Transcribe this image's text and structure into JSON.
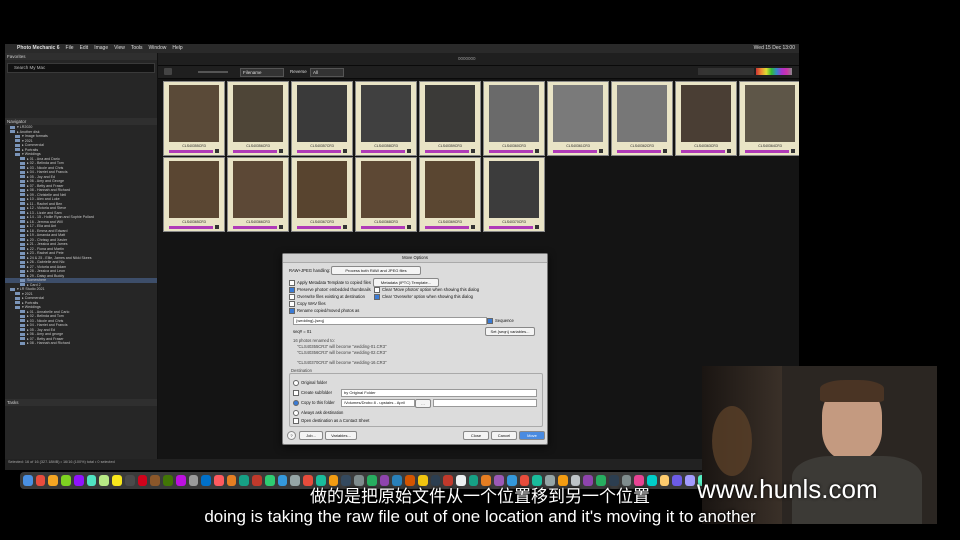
{
  "app": {
    "title": "Photo Mechanic 6"
  },
  "menubar": {
    "items": [
      "Photo Mechanic 6",
      "File",
      "Edit",
      "Image",
      "View",
      "Tools",
      "Window",
      "Help"
    ],
    "clock": "Wed 15 Dec 13:00"
  },
  "window": {
    "title": "0000000"
  },
  "sidebar": {
    "favorites_label": "Favorites",
    "search_placeholder": "Search My Mac",
    "navigator_label": "Navigator",
    "tasks_label": "Tasks",
    "tree": [
      "▾ LR2020",
      "▸ Another disk",
      "▾ Image formats",
      "▾ 2021",
      "▸ Commercial",
      "▸ Portraits",
      "▾ Weddings",
      "▸ 01 - Ana and Dario",
      "▸ 02 - Belinda and Tom",
      "▸ 03 - Nicole and Chris",
      "▸ 04 - Harriet and Francis",
      "▸ 05 - Joy and Ed",
      "▸ 06 - Amy and George",
      "▸ 07 - Betty and Fraser",
      "▸ 08 - Hannah and Richard",
      "▸ 09 - Christelle and Neil",
      "▸ 10 - Alex and Luke",
      "▸ 11 - Rachel and Ben",
      "▸ 12 - Victoria and Steve",
      "▸ 13 - Lizzie and Sam",
      "▸ 14 - 15 - Hollie Ryan and Sophie Pollard",
      "▸ 16 - Jemma and Will",
      "▸ 17 - Ella and Ant",
      "▸ 18 - Emma and Edward",
      "▸ 19 - Amanda and Matt",
      "▸ 20 - Chrissy and Xavier",
      "▸ 21 - Jessica and James",
      "▸ 22 - Fiona and Martin",
      "▸ 23 - Rachel and Pete",
      "▸ 24 & 25 - Ellie, James and Nikki Skees",
      "▸ 26 - Gabrielle and Nic",
      "▸ 27 - Victoria and Adam",
      "▸ 28 - Jessica and Leon",
      "▸ 29 - Daisy and Buddy",
      "Somewhere",
      "▸ Card 2",
      "▾ LR Studio 2021",
      "▾ 2021",
      "▸ Commercial",
      "▸ Portraits",
      "▾ Weddings",
      "▸ 01 - Annabelle and Carlo",
      "▸ 02 - Belinda and Tom",
      "▸ 03 - Nicole and Chris",
      "▸ 04 - Harriet and Francis",
      "▸ 05 - Joy and Ed",
      "▸ 06 - Amy and george",
      "▸ 07 - Betty and Fraser",
      "▸ 08 - Hannah and Richard"
    ],
    "selected_index": 34
  },
  "toolbar": {
    "sort": "Filename",
    "reverse_label": "Reverse",
    "filter": "All"
  },
  "thumbnails": [
    {
      "name": "CLS40355CR3"
    },
    {
      "name": "CLS40356CR3"
    },
    {
      "name": "CLS40357CR3"
    },
    {
      "name": "CLS40358CR3"
    },
    {
      "name": "CLS40359CR3"
    },
    {
      "name": "CLS40360CR3"
    },
    {
      "name": "CLS40361CR3"
    },
    {
      "name": "CLS40362CR3"
    },
    {
      "name": "CLS40363CR3"
    },
    {
      "name": "CLS40364CR3"
    },
    {
      "name": "CLS40365CR3"
    },
    {
      "name": "CLS40366CR3"
    },
    {
      "name": "CLS40367CR3"
    },
    {
      "name": "CLS40368CR3"
    },
    {
      "name": "CLS40369CR3"
    },
    {
      "name": "CLS40370CR3"
    }
  ],
  "status_bar": "Selected: 16 of 16 (327.18MB) • 16/16 (100%) total • 0 selected",
  "dialog": {
    "title": "Move Options",
    "raw_jpeg_label": "RAW+JPEG handling:",
    "raw_jpeg_value": "Process both RAW and JPEG files",
    "apply_template": "Apply Metadata Template to copied files",
    "template_button": "Metadata (IPTC) Template...",
    "preserve_thumbs": "Preserve photos' embedded thumbnails",
    "overwrite": "Overwrite files existing at destination",
    "copy_wav": "Copy WAV files",
    "rename": "Rename copied/moved photos as",
    "clear_move": "Clear 'Move photos' option when showing this dialog",
    "clear_overwrite": "Clear 'Overwrite' option when showing this dialog",
    "rename_value": "{wedding}-{seq}",
    "sequence_label": "Sequence",
    "set_vars": "Set {seqn} variables...",
    "seq_start": "seq# = 01",
    "preview_label": "16 photos renamed to:",
    "preview_1": "\"CLS40355CR3\" will become \"wedding-01.CR3\"",
    "preview_2": "\"CLS40356CR3\" will become \"wedding-02.CR3\"",
    "preview_last": "\"CLS40370CR3\" will become \"wedding-16.CR3\"",
    "destination_label": "Destination",
    "original_folder": "Original folder",
    "create_subfolder": "Create subfolder",
    "create_subfolder_value": "by Original Folder",
    "copy_to_folder": "Copy to this folder",
    "folder_path": "/Volumes/Drobo 8 - upstairs - April Wedd...",
    "always_ask": "Always ask destination",
    "open_contact": "Open destination as a Contact Sheet",
    "help": "?",
    "jobs_button": "Job...",
    "variables_button": "Variables...",
    "close_button": "Close",
    "cancel_button": "Cancel",
    "move_button": "Move"
  },
  "subtitles": {
    "chinese": "做的是把原始文件从一个位置移到另一个位置",
    "english": "doing is taking the raw file out of one location and it's moving it to another"
  },
  "watermark": "www.hunls.com",
  "colors": {
    "label_bar": "#b03ab8",
    "thumb_bg": "#e9e4c6",
    "selection": "#3d4e6a",
    "accent": "#3a7bd5"
  }
}
